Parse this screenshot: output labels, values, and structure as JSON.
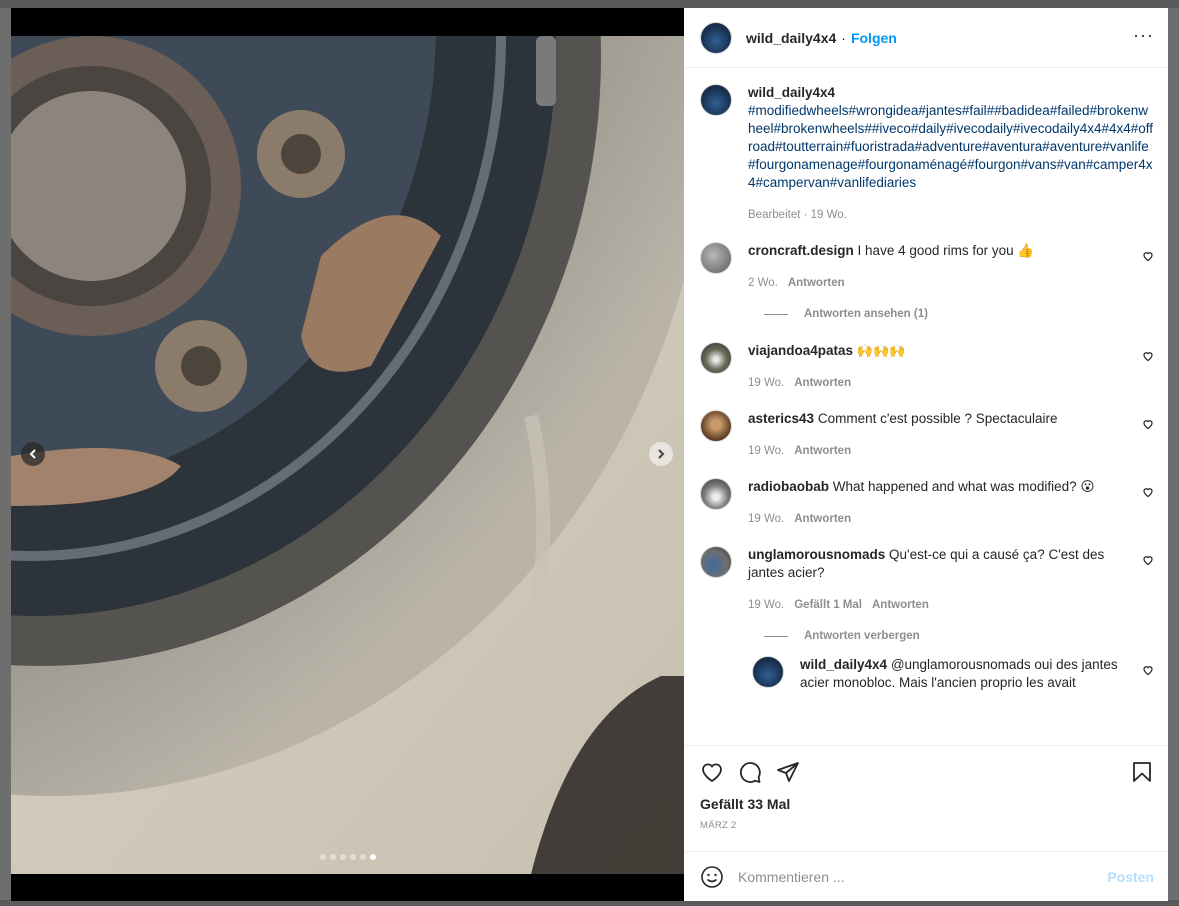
{
  "post": {
    "username": "wild_daily4x4",
    "separator": "·",
    "follow_label": "Folgen",
    "more_label": "···"
  },
  "caption": {
    "username": "wild_daily4x4",
    "hashtags": "#modifiedwheels#wrongidea#jantes#fail##badidea#failed#brokenwheel#brokenwheels##iveco#daily#ivecodaily#ivecodaily4x4#4x4#offroad#toutterrain#fuoristrada#adventure#aventura#aventure#vanlife#fourgonamenage#fourgonaménagé#fourgon#vans#van#camper4x4#campervan#vanlifediaries",
    "meta": "Bearbeitet · 19 Wo."
  },
  "comments": [
    {
      "username": "croncraft.design",
      "text": "I have 4 good rims for you 👍",
      "time": "2 Wo.",
      "likes": "",
      "reply": "Antworten",
      "toggle": "Antworten ansehen (1)"
    },
    {
      "username": "viajandoa4patas",
      "text": "🙌🙌🙌",
      "time": "19 Wo.",
      "likes": "",
      "reply": "Antworten",
      "toggle": ""
    },
    {
      "username": "asterics43",
      "text": "Comment c'est possible ? Spectaculaire",
      "time": "19 Wo.",
      "likes": "",
      "reply": "Antworten",
      "toggle": ""
    },
    {
      "username": "radiobaobab",
      "text": "What happened and what was modified? 😮",
      "time": "19 Wo.",
      "likes": "",
      "reply": "Antworten",
      "toggle": ""
    },
    {
      "username": "unglamorousnomads",
      "text": "Qu'est-ce qui a causé ça? C'est des jantes acier?",
      "time": "19 Wo.",
      "likes": "Gefällt 1 Mal",
      "reply": "Antworten",
      "toggle": "Antworten verbergen"
    }
  ],
  "nested_reply": {
    "username": "wild_daily4x4",
    "text": "@unglamorousnomads oui des jantes acier monobloc. Mais l'ancien proprio les avait"
  },
  "actions": {
    "likes_text": "Gefällt 33 Mal",
    "date": "MÄRZ 2"
  },
  "comment_box": {
    "placeholder": "Kommentieren ...",
    "post_label": "Posten"
  },
  "carousel": {
    "slide_count": 6,
    "active_index": 5
  },
  "colors": {
    "accent": "#0095f6",
    "hashtag": "#00376b",
    "muted": "#8e8e8e",
    "post_disabled": "#b2dffc"
  },
  "icons": [
    "chevron-left-icon",
    "chevron-right-icon",
    "more-icon",
    "heart-icon",
    "comment-icon",
    "share-icon",
    "bookmark-icon",
    "emoji-icon"
  ]
}
